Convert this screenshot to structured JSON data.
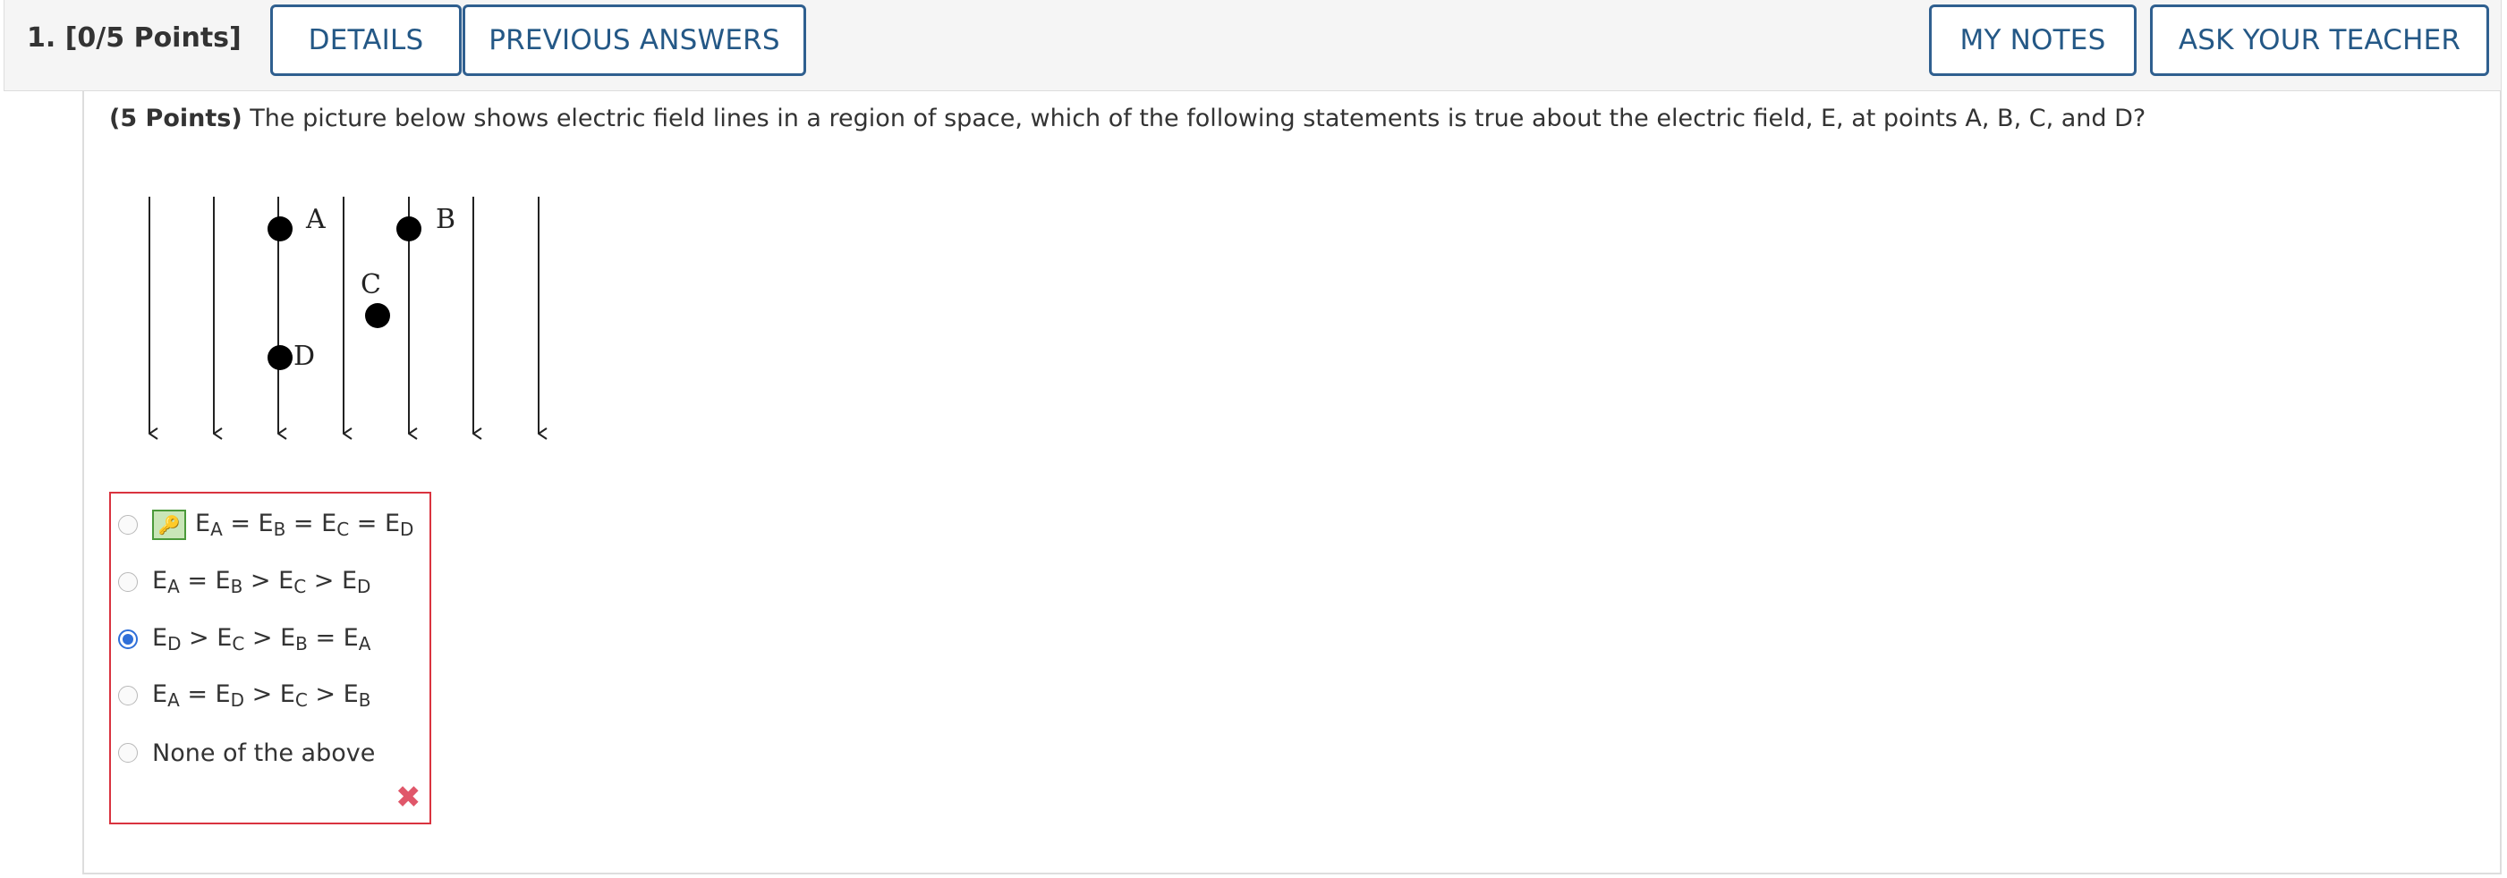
{
  "header": {
    "question_label": "1.  [0/5 Points]",
    "details_label": "DETAILS",
    "previous_answers_label": "PREVIOUS ANSWERS",
    "my_notes_label": "MY NOTES",
    "ask_teacher_label": "ASK YOUR TEACHER"
  },
  "question": {
    "points": "(5 Points)",
    "text": "The picture below shows electric field lines in a region of space, which of the following statements is true about the electric field, E, at points A, B, C, and D?"
  },
  "diagram": {
    "point_labels": [
      "A",
      "B",
      "C",
      "D"
    ]
  },
  "answers": {
    "options": [
      {
        "parts": [
          "E",
          "A",
          " = E",
          "B",
          " = E",
          "C",
          " = E",
          "D"
        ],
        "key": true,
        "selected": false
      },
      {
        "parts": [
          "E",
          "A",
          " = E",
          "B",
          " > E",
          "C",
          " > E",
          "D"
        ],
        "key": false,
        "selected": false
      },
      {
        "parts": [
          "E",
          "D",
          " > E",
          "C",
          " > E",
          "B",
          " = E",
          "A"
        ],
        "key": false,
        "selected": true
      },
      {
        "parts": [
          "E",
          "A",
          " = E",
          "D",
          " > E",
          "C",
          " > E",
          "B"
        ],
        "key": false,
        "selected": false
      },
      {
        "text": "None of the above",
        "key": false,
        "selected": false
      }
    ],
    "result_icon": "incorrect-x-icon",
    "key_icon": "key-icon"
  },
  "colors": {
    "button_border": "#2f5f8f",
    "button_text": "#245886",
    "wrong_border": "#d9333f",
    "radio_selected": "#2f6fd8",
    "x_mark": "#e0576a"
  }
}
